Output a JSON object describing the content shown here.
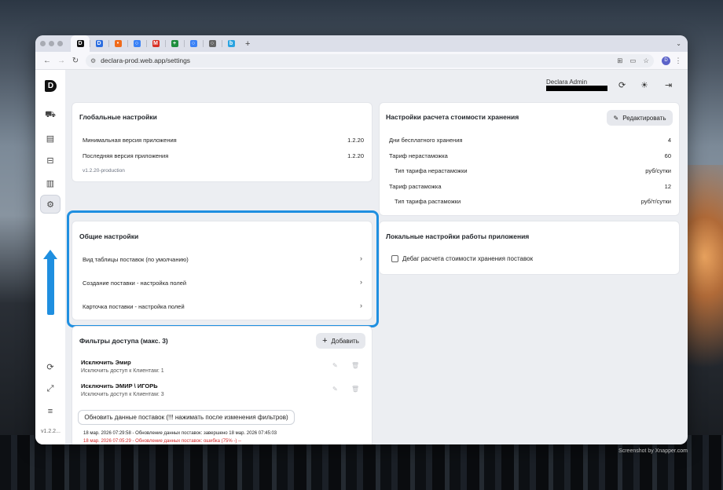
{
  "browser": {
    "tabs": [
      {
        "icon": "declara-favicon",
        "color": "#111111",
        "glyph": "D",
        "active": true
      },
      {
        "icon": "declara-favicon-blue",
        "color": "#2b6de0",
        "glyph": "D"
      },
      {
        "icon": "fire-icon",
        "color": "#f06a1a",
        "glyph": "•"
      },
      {
        "icon": "search-icon",
        "color": "#3b82f6",
        "glyph": "○"
      },
      {
        "icon": "gmail-icon",
        "color": "#d93025",
        "glyph": "M"
      },
      {
        "icon": "sheets-icon",
        "color": "#1e8e3e",
        "glyph": "+"
      },
      {
        "icon": "search-icon",
        "color": "#3b82f6",
        "glyph": "○"
      },
      {
        "icon": "settings-icon",
        "color": "#666666",
        "glyph": "○"
      },
      {
        "icon": "bing-icon",
        "color": "#2aa3e0",
        "glyph": "b"
      }
    ],
    "new_tab": "+",
    "url": "declara-prod.web.app/settings",
    "profile_initial": "D"
  },
  "sidebar": {
    "logo": "D",
    "version": "v1.2.2..."
  },
  "header": {
    "user_name": "Declara Admin"
  },
  "global_settings": {
    "title": "Глобальные настройки",
    "rows": [
      {
        "label": "Минимальная версия приложения",
        "value": "1.2.20"
      },
      {
        "label": "Последняя версия приложения",
        "value": "1.2.20"
      }
    ],
    "build": "v1.2.20-production"
  },
  "storage_settings": {
    "title": "Настройки расчета стоимости хранения",
    "edit_label": "Редактировать",
    "rows": [
      {
        "label": "Дни бесплатного хранения",
        "value": "4"
      },
      {
        "label": "Тариф нерастаможка",
        "value": "60"
      },
      {
        "label": "Тип тарифа нерастаможки",
        "value": "руб/сутки"
      },
      {
        "label": "Тариф растаможка",
        "value": "12"
      },
      {
        "label": "Тип тарифа растаможки",
        "value": "руб/т/сутки"
      }
    ]
  },
  "general_settings": {
    "title": "Общие настройки",
    "items": [
      "Вид таблицы поставок (по умолчанию)",
      "Создание поставки - настройка полей",
      "Карточка поставки - настройка полей"
    ]
  },
  "local_settings": {
    "title": "Локальные настройки работы приложения",
    "checkbox_label": "Дебаг расчета стоимости хранения поставок",
    "checked": false
  },
  "access_filters": {
    "title": "Фильтры доступа (макс. 3)",
    "add_label": "Добавить",
    "filters": [
      {
        "name": "Исключить Эмир",
        "detail": "Исключить доступ к Клиентам: 1"
      },
      {
        "name": "Исключить ЭМИР \\ ИГОРЬ",
        "detail": "Исключить доступ к Клиентам: 3"
      }
    ],
    "refresh_label": "Обновить данные поставок (!!! нажимать после изменения фильтров)",
    "logs": [
      {
        "text": "18 мар. 2026 07:29:58 - Обновление данных поставок: завершено 18 мар. 2026 07:45:03",
        "error": false
      },
      {
        "text": "18 мар. 2026 07:05:29 - Обновление данных поставок: ошибка (75% -) --",
        "error": true
      }
    ]
  },
  "watermark": "Screenshot by Xnapper.com",
  "colors": {
    "highlight": "#1f8fe0",
    "error": "#d62828"
  }
}
